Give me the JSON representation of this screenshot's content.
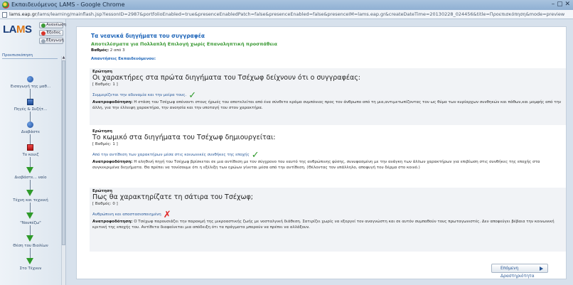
{
  "window": {
    "title": "Εκπαιδευόμενος LAMS - Google Chrome",
    "controls": "–  ▢  ✕"
  },
  "address_bar": {
    "host": "lams.eap.gr",
    "path": "/lams/learning/mainflash.jsp?lessonID=2987&portfolioEnabled=true&presenceEnabledPatch=false&presenceEnabled=false&presenceIM=lams.eap.gr&createDateTime=20130228_024456&title=Προεπισκόπηση&mode=preview"
  },
  "sidebar": {
    "logo": "LAMS",
    "buttons": [
      {
        "label": "Ανανέωση",
        "color": "#3c9a36"
      },
      {
        "label": "Έξοδος",
        "color": "#d9352a"
      },
      {
        "label": "Εξαγωγή",
        "color": "#9aa7b6"
      }
    ],
    "section_label": "Προεπισκόπηση",
    "activities": [
      {
        "label": "Εισαγωγή της μαθ...",
        "shape": "circle"
      },
      {
        "label": "Πηγές & Συζήτ...",
        "shape": "square"
      },
      {
        "label": "Διαβάστε",
        "shape": "circle"
      },
      {
        "label": "Το κουιζ",
        "shape": "red"
      },
      {
        "label": "Διαβάστε... ναίο",
        "shape": "tri"
      },
      {
        "label": "Τέχνη και τεχνική",
        "shape": "tri"
      },
      {
        "label": "\"Νουπέζω\"",
        "shape": "tri"
      },
      {
        "label": "Θέση του Βιολίων",
        "shape": "tri"
      },
      {
        "label": "Στο Τέχνυν",
        "shape": "tri"
      }
    ]
  },
  "main": {
    "title": "Τα νεανικά διηγήματα του συγγραφέα",
    "subtitle": "Αποτελέσματα για Πολλαπλή Επιλογή χωρίς Επαναληπτική προσπάθεια",
    "mark_label": "Βαθμός:",
    "mark_value": "2 από 3",
    "answers_label": "Απαντήσεις Εκπαιδευόμενου:",
    "questions": [
      {
        "label": "Ερώτηση",
        "text": "Οι χαρακτήρες στα πρώτα διηγήματα του Τσέχωφ δείχνουν ότι ο συγγραφέας:",
        "marks": "[ Βαθμός: 1 ]",
        "answer": "Συμμερίζεται την αδυναμία και την μοίρα τους.",
        "correct": true,
        "feedback_label": "Ανατροφοδότηση:",
        "feedback": "Η στάση του Τσέχωφ απέναντι στους ήρωές του αποτελείται από ένα σύνθετο κράμα συμπόνιας προς τον άνθρωπο από τη μια,αντιμετωπίζοντας τον ως θύμα των κυρίαρχων συνθηκών και πάθων,και μομφής από την άλλη, για την έλλειψη χαρακτήρα, την ανοησία και την υποταγή του στον χαρακτήρα."
      },
      {
        "label": "Ερώτηση",
        "text": "Το κωμικό στα διηγήματα του Τσέχωφ δημιουργείται:",
        "marks": "[ Βαθμός: 1 ]",
        "answer": "Από την αντίθεση των χαρακτήρων μέσα στις κοινωνικές συνθήκες της εποχής",
        "correct": true,
        "feedback_label": "Ανατροφοδότηση:",
        "feedback": "Η αληθινή πηγή του Τσέχωφ βρίσκεται σε μια αντίθεση με τον σύγχρονο του εαυτό της ανθρώπινης φύσης, συνυφασμένη με την ανάγκη των άλλων χαρακτήρων για επιβίωση στις συνθήκες της εποχής στα συγκεκριμένα διηγήματα. Θα πρέπει να τονίσουμε ότι η εξέλιξη των ηρώων γίνεται μέσα από την αντίθεση. (Θέλοντας τον υπάλληλο, αποφυγή του δέρμα στο κοινό.)"
      },
      {
        "label": "Ερώτηση",
        "text": "Πως θα χαρακτηρίζατε τη σάτιρα του Τσέχωφ;",
        "marks": "[ Βαθμός: 0 ]",
        "answer": "Ανθρώπινη και αποστασιοποιημένη",
        "correct": false,
        "feedback_label": "Ανατροφοδότηση:",
        "feedback": "Ο Τσέχωφ παρουσιάζει την παρακμή της μικροαστικής ζωής με νοσταλγική διάθεση. Σατιρίζει χωρίς να εξοργεί τον αναγνώστη και σε αυτόν συμπαθούν τους πρωταγωνιστές. Δεν αποφεύγει βέβαια την κοινωνική κριτική της εποχής του. Αντίθετα διαφαίνεται μια απόδειξη ότι τα πράγματα μπορούν να πρέπει να αλλάξουν."
      }
    ],
    "next_button": "Επόμενη Δραστηριότητα"
  }
}
